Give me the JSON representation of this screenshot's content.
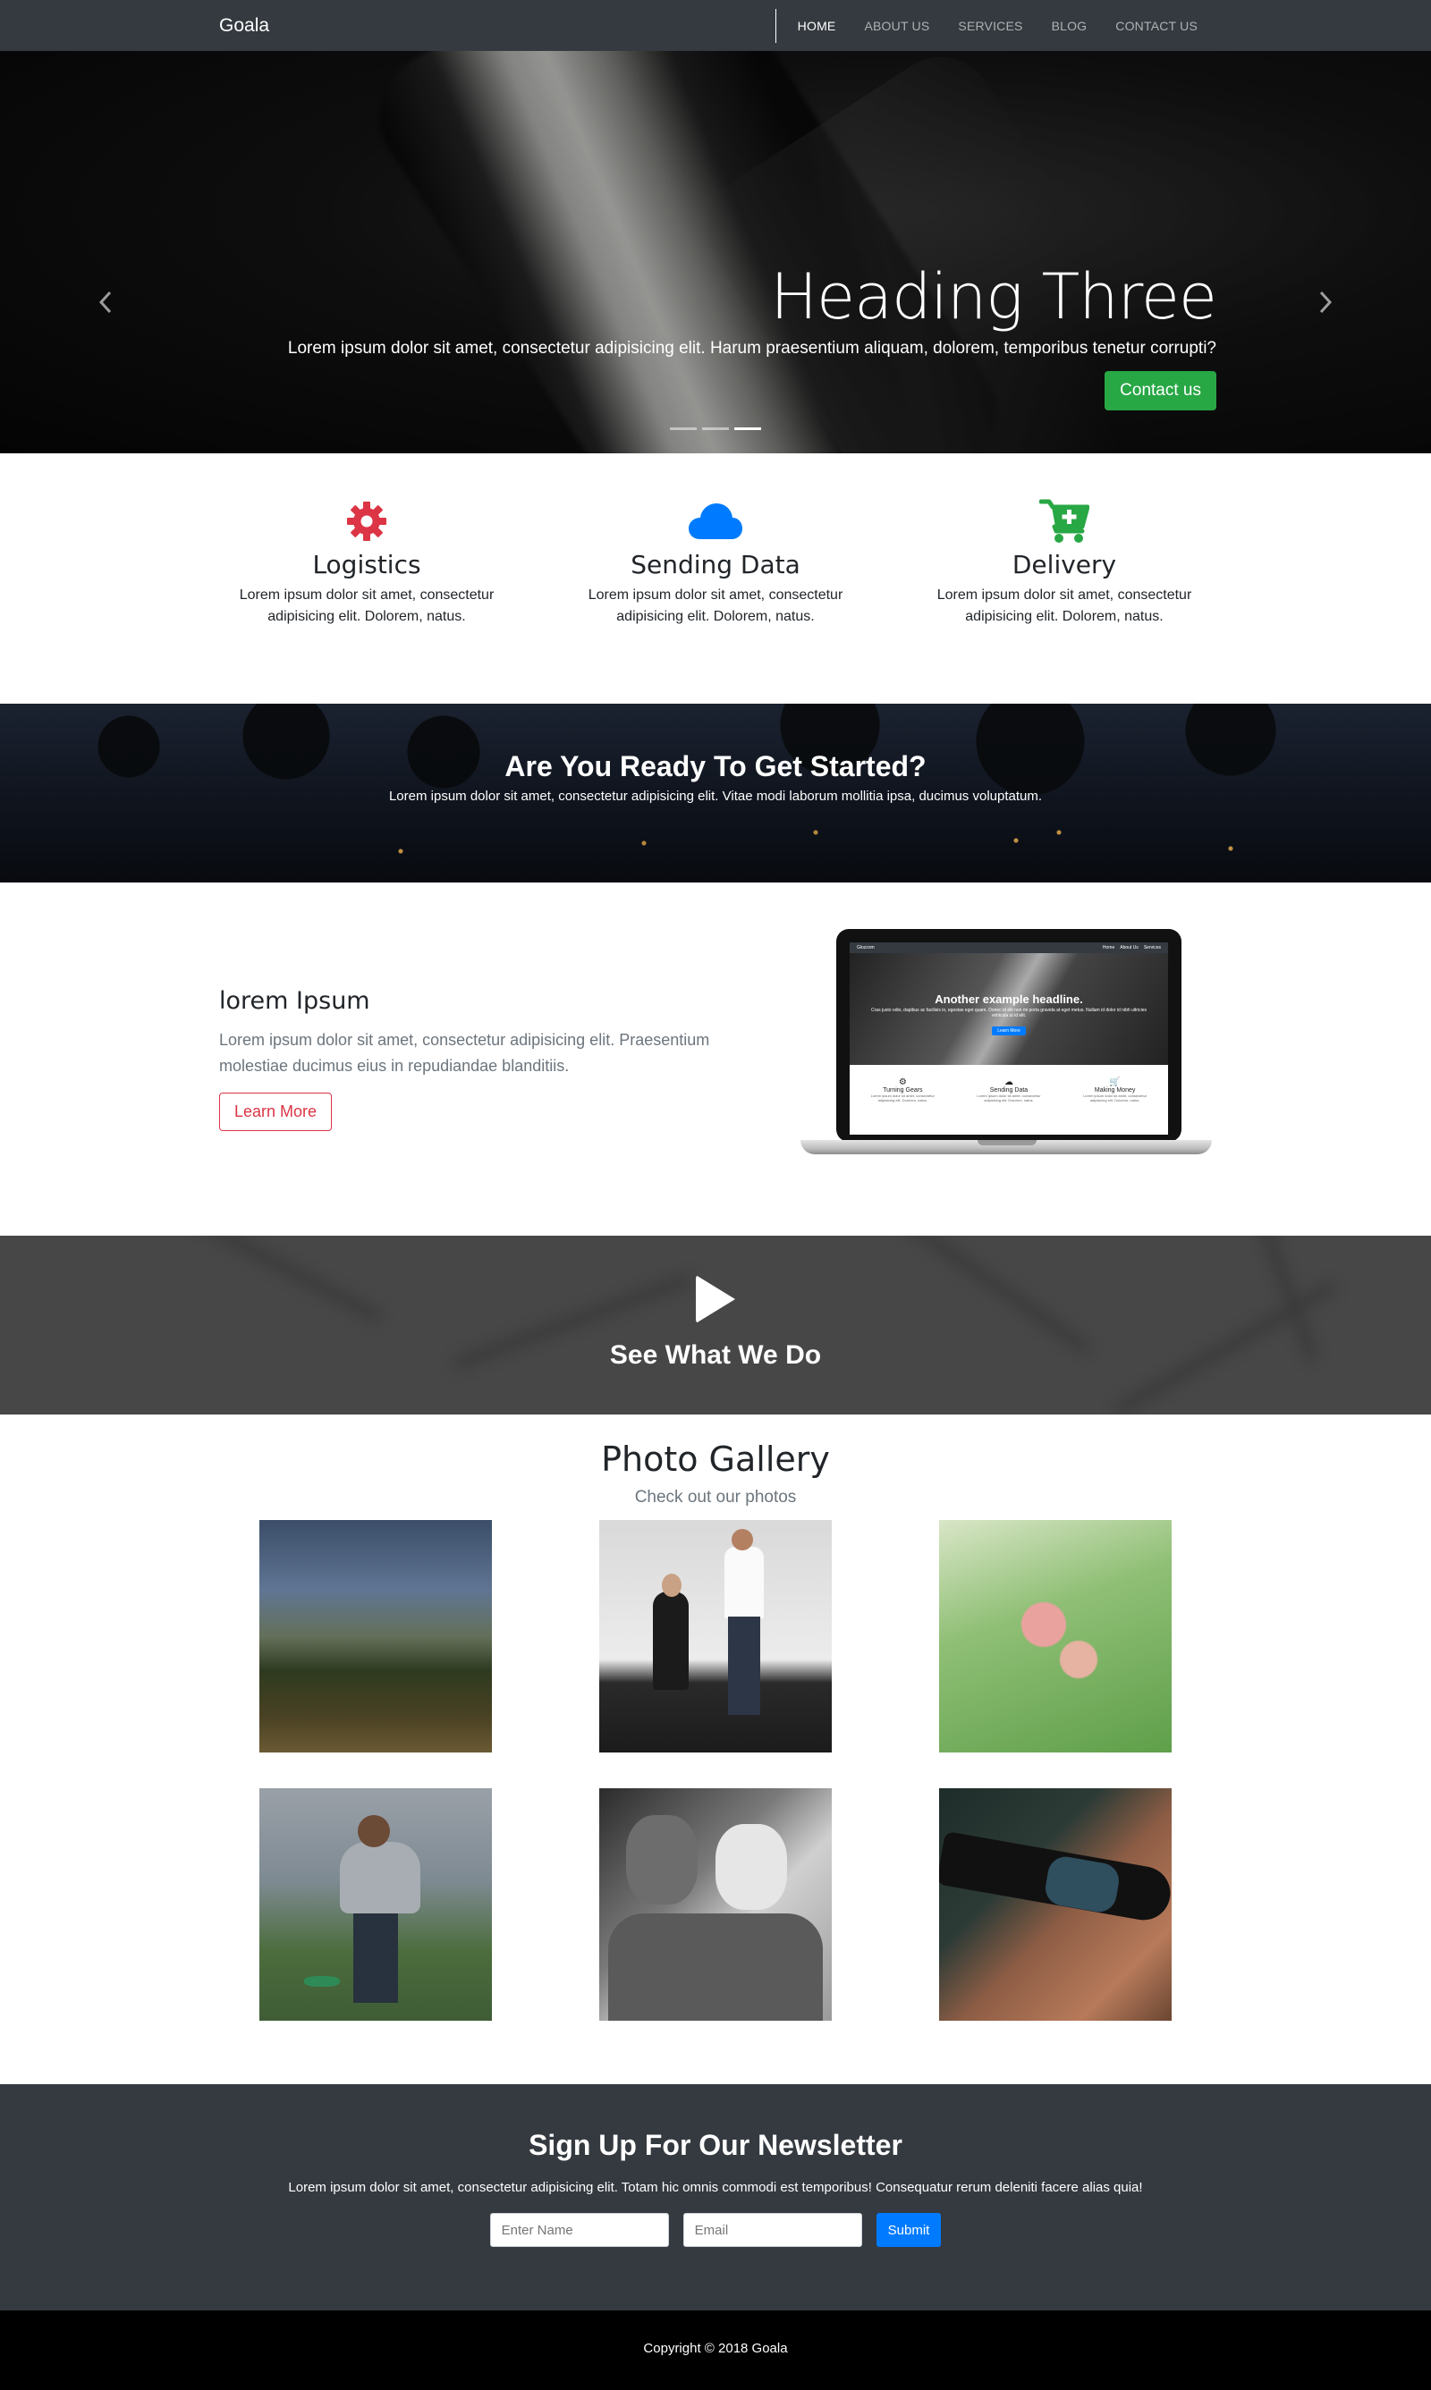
{
  "navbar": {
    "brand": "Goala",
    "links": [
      "HOME",
      "ABOUT US",
      "SERVICES",
      "BLOG",
      "CONTACT US"
    ]
  },
  "hero": {
    "heading": "Heading Three",
    "text": "Lorem ipsum dolor sit amet, consectetur adipisicing elit. Harum praesentium aliquam, dolorem, temporibus tenetur corrupti?",
    "button": "Contact us",
    "prev_icon": "chevron-left-icon",
    "next_icon": "chevron-right-icon",
    "slide_count": 3,
    "active_slide": 3
  },
  "features": [
    {
      "icon": "gear-icon",
      "color": "#dc3545",
      "title": "Logistics",
      "text": "Lorem ipsum dolor sit amet, consectetur adipisicing elit. Dolorem, natus."
    },
    {
      "icon": "cloud-icon",
      "color": "#007bff",
      "title": "Sending Data",
      "text": "Lorem ipsum dolor sit amet, consectetur adipisicing elit. Dolorem, natus."
    },
    {
      "icon": "cart-plus-icon",
      "color": "#28a745",
      "title": "Delivery",
      "text": "Lorem ipsum dolor sit amet, consectetur adipisicing elit. Dolorem, natus."
    }
  ],
  "cta": {
    "heading": "Are You Ready To Get Started?",
    "text": "Lorem ipsum dolor sit amet, consectetur adipisicing elit. Vitae modi laborum mollitia ipsa, ducimus voluptatum."
  },
  "info": {
    "heading": "lorem Ipsum",
    "text": "Lorem ipsum dolor sit amet, consectetur adipisicing elit. Praesentium molestiae ducimus eius in repudiandae blanditiis.",
    "button": "Learn More",
    "laptop_screen": {
      "brand": "Glozzom",
      "nav": [
        "Home",
        "About Us",
        "Services"
      ],
      "headline": "Another example headline.",
      "text": "Cras justo odio, dapibus ac facilisis in, egestas eget quam. Donec id elit non mi porta gravida at eget metus. Nullam id dolor id nibh ultricies vehicula ut id elit.",
      "button": "Learn More",
      "features": [
        {
          "icon": "gear-icon",
          "title": "Turning Gears",
          "text": "Lorem ipsum dolor sit amet, consectetur adipisicing elit. Dolorem, natus."
        },
        {
          "icon": "cloud-icon",
          "title": "Sending Data",
          "text": "Lorem ipsum dolor sit amet, consectetur adipisicing elit. Dolorem, natus."
        },
        {
          "icon": "cart-icon",
          "title": "Making Money",
          "text": "Lorem ipsum dolor sit amet, consectetur adipisicing elit. Dolorem, natus."
        }
      ]
    }
  },
  "video": {
    "icon": "play-icon",
    "heading": "See What We Do"
  },
  "gallery": {
    "heading": "Photo Gallery",
    "subheading": "Check out our photos",
    "photos": [
      "gallery-photo-forest",
      "gallery-photo-couple",
      "gallery-photo-flower",
      "gallery-photo-child",
      "gallery-photo-elderly-couple",
      "gallery-photo-sunglasses"
    ]
  },
  "newsletter": {
    "heading": "Sign Up For Our Newsletter",
    "text": "Lorem ipsum dolor sit amet, consectetur adipisicing elit. Totam hic omnis commodi est temporibus! Consequatur rerum deleniti facere alias quia!",
    "name_placeholder": "Enter Name",
    "email_placeholder": "Email",
    "button": "Submit"
  },
  "footer": {
    "copyright": "Copyright © 2018 Goala"
  }
}
